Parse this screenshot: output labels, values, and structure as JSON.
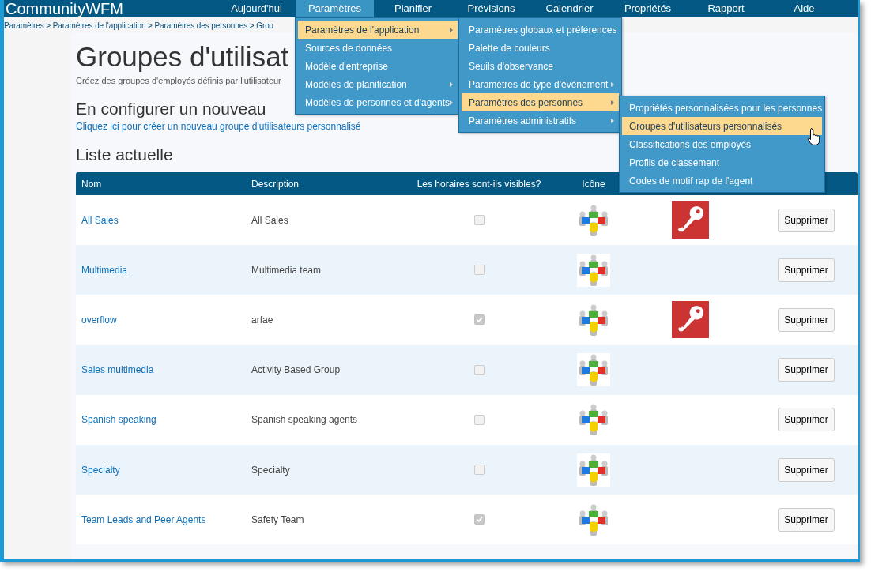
{
  "logo": "CommunityWFM",
  "nav": [
    {
      "label": "Aujourd'hui",
      "selected": false
    },
    {
      "label": "Paramètres",
      "selected": true
    },
    {
      "label": "Planifier",
      "selected": false
    },
    {
      "label": "Prévisions",
      "selected": false
    },
    {
      "label": "Calendrier",
      "selected": false
    },
    {
      "label": "Propriétés",
      "selected": false
    },
    {
      "label": "Rapport",
      "selected": false
    },
    {
      "label": "Aide",
      "selected": false
    }
  ],
  "breadcrumb": "Paramètres > Paramètres de l'application > Paramètres des personnes > Grou",
  "title": "Groupes d'utilisat",
  "subtitle": "Créez des groupes d'employés définis par l'utilisateur",
  "new_heading": "En configurer un nouveau",
  "new_link": "Cliquez ici pour créer un nouveau groupe d'utilisateurs personnalisé",
  "list_heading": "Liste actuelle",
  "table": {
    "columns": [
      "Nom",
      "Description",
      "Les horaires sont-ils visibles?",
      "Icône"
    ],
    "rows": [
      {
        "name": "All Sales",
        "description": "All Sales",
        "schedules_visible": false,
        "secured": true,
        "action": "Supprimer"
      },
      {
        "name": "Multimedia",
        "description": "Multimedia team",
        "schedules_visible": false,
        "secured": false,
        "action": "Supprimer"
      },
      {
        "name": "overflow",
        "description": "arfae",
        "schedules_visible": true,
        "secured": true,
        "action": "Supprimer"
      },
      {
        "name": "Sales multimedia",
        "description": "Activity Based Group",
        "schedules_visible": false,
        "secured": false,
        "action": "Supprimer"
      },
      {
        "name": "Spanish speaking",
        "description": "Spanish speaking agents",
        "schedules_visible": false,
        "secured": false,
        "action": "Supprimer"
      },
      {
        "name": "Specialty",
        "description": "Specialty",
        "schedules_visible": false,
        "secured": false,
        "action": "Supprimer"
      },
      {
        "name": "Team Leads and Peer Agents",
        "description": "Safety Team",
        "schedules_visible": true,
        "secured": false,
        "action": "Supprimer"
      }
    ]
  },
  "menus": [
    {
      "items": [
        {
          "label": "Paramètres de l'application",
          "submenu": true,
          "selected": true
        },
        {
          "label": "Sources de données",
          "submenu": false,
          "selected": false
        },
        {
          "label": "Modèle d'entreprise",
          "submenu": false,
          "selected": false
        },
        {
          "label": "Modèles de planification",
          "submenu": true,
          "selected": false
        },
        {
          "label": "Modèles de personnes et d'agents",
          "submenu": true,
          "selected": false
        }
      ]
    },
    {
      "items": [
        {
          "label": "Paramètres globaux et préférences",
          "submenu": false,
          "selected": false
        },
        {
          "label": "Palette de couleurs",
          "submenu": false,
          "selected": false
        },
        {
          "label": "Seuils d'observance",
          "submenu": false,
          "selected": false
        },
        {
          "label": "Paramètres de type d'événement",
          "submenu": true,
          "selected": false
        },
        {
          "label": "Paramètres des personnes",
          "submenu": true,
          "selected": true
        },
        {
          "label": "Paramètres administratifs",
          "submenu": true,
          "selected": false
        }
      ]
    },
    {
      "items": [
        {
          "label": "Propriétés personnalisées pour les personnes",
          "submenu": false,
          "selected": false
        },
        {
          "label": "Groupes d'utilisateurs personnalisés",
          "submenu": false,
          "selected": true
        },
        {
          "label": "Classifications des employés",
          "submenu": false,
          "selected": false
        },
        {
          "label": "Profils de classement",
          "submenu": false,
          "selected": false
        },
        {
          "label": "Codes de motif rap de l'agent",
          "submenu": false,
          "selected": false
        }
      ]
    }
  ]
}
